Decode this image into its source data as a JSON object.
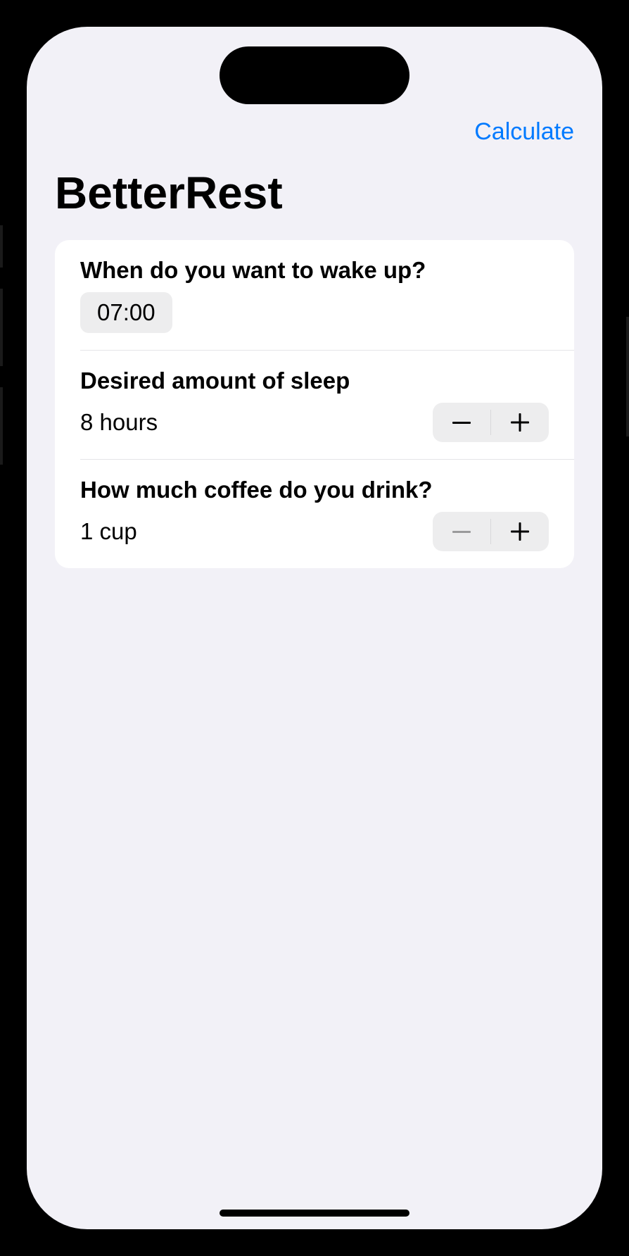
{
  "nav": {
    "calculate_label": "Calculate"
  },
  "page": {
    "title": "BetterRest"
  },
  "form": {
    "wake": {
      "title": "When do you want to wake up?",
      "time_value": "07:00"
    },
    "sleep": {
      "title": "Desired amount of sleep",
      "value": "8 hours"
    },
    "coffee": {
      "title": "How much coffee do you drink?",
      "value": "1 cup"
    }
  }
}
